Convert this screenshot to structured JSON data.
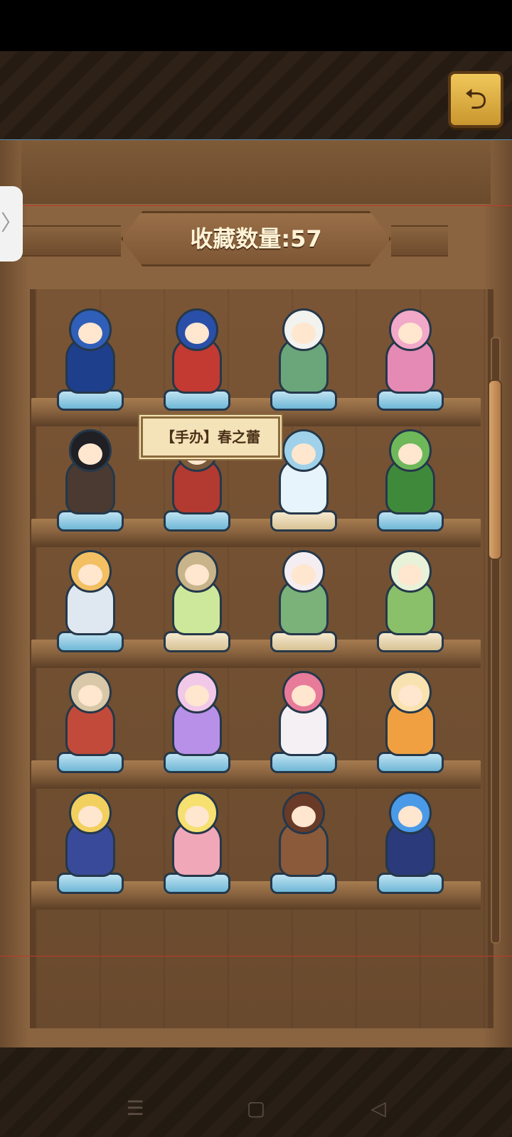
{
  "header": {
    "collection_label": "收藏数量:57"
  },
  "tooltip": {
    "text": "【手办】春之蕾"
  },
  "side_tab": {
    "glyph": "〉"
  },
  "back_button": {
    "icon": "return-arrow-icon",
    "glyph": "⮌"
  },
  "navbar": {
    "menu": "☰",
    "home": "▢",
    "back": "◁"
  },
  "colors": {
    "wood": "#8a6440",
    "gold": "#f0c75a",
    "shelf_dark": "#5c3f26"
  },
  "figures": [
    {
      "hair": "#2f5fb8",
      "outfit": "#1e3f8c",
      "base": "blue"
    },
    {
      "hair": "#2a4fa8",
      "outfit": "#c23a32",
      "base": "blue"
    },
    {
      "hair": "#f2f2ee",
      "outfit": "#6aa67a",
      "base": "blue"
    },
    {
      "hair": "#f2a8c8",
      "outfit": "#e48ab4",
      "base": "blue"
    },
    {
      "hair": "#1f1f24",
      "outfit": "#4a3a32",
      "base": "blue"
    },
    {
      "hair": "#7a5a3a",
      "outfit": "#b23a30",
      "base": "blue"
    },
    {
      "hair": "#9fd2ea",
      "outfit": "#e8f4fb",
      "base": "cream"
    },
    {
      "hair": "#6eb85a",
      "outfit": "#3f8a3a",
      "base": "blue"
    },
    {
      "hair": "#f2c062",
      "outfit": "#dfe8f0",
      "base": "blue"
    },
    {
      "hair": "#c8b48a",
      "outfit": "#cde89a",
      "base": "cream"
    },
    {
      "hair": "#f4eef2",
      "outfit": "#7ab27a",
      "base": "cream"
    },
    {
      "hair": "#e8f2d8",
      "outfit": "#8ac06a",
      "base": "cream"
    },
    {
      "hair": "#d8c8a8",
      "outfit": "#c24a3a",
      "base": "blue"
    },
    {
      "hair": "#f2c8e8",
      "outfit": "#b890e8",
      "base": "blue"
    },
    {
      "hair": "#e87a9a",
      "outfit": "#f4f0f4",
      "base": "blue"
    },
    {
      "hair": "#f8e2b0",
      "outfit": "#f0a040",
      "base": "blue"
    },
    {
      "hair": "#f2d060",
      "outfit": "#3a4a9a",
      "base": "blue"
    },
    {
      "hair": "#f6e070",
      "outfit": "#f0a8b8",
      "base": "blue"
    },
    {
      "hair": "#6a3a28",
      "outfit": "#8a5a3a",
      "base": "blue"
    },
    {
      "hair": "#4a9ae8",
      "outfit": "#2a3a7a",
      "base": "blue"
    }
  ]
}
